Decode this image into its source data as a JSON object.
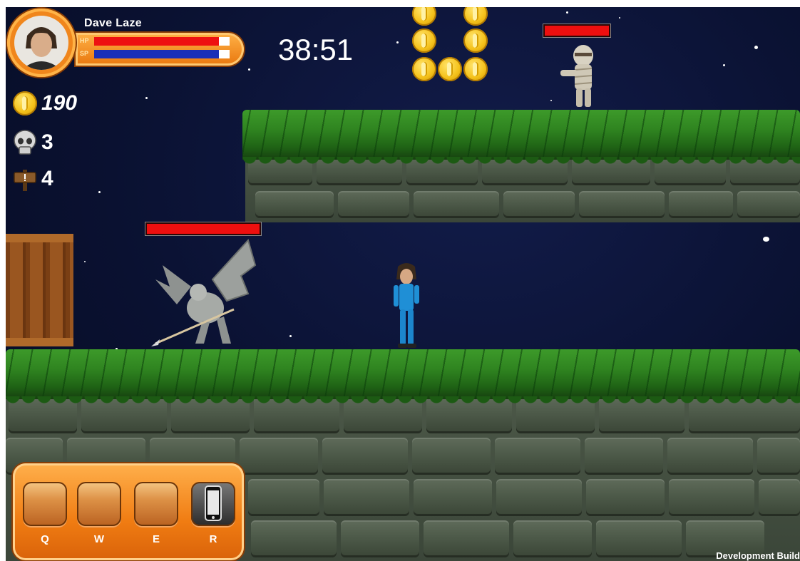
{
  "hud": {
    "player_name": "Dave Laze",
    "hp_label": "HP",
    "sp_label": "SP",
    "hp_fraction": 0.92,
    "sp_fraction": 0.92,
    "timer": "38:51",
    "coins": "190",
    "kills": "3",
    "signs": "4"
  },
  "enemies": [
    {
      "name": "mummy",
      "hp_fraction": 1.0
    },
    {
      "name": "gargoyle",
      "hp_fraction": 1.0
    }
  ],
  "skills": {
    "keys": [
      "Q",
      "W",
      "E",
      "R"
    ]
  },
  "footer": {
    "dev_build": "Development Build"
  },
  "colors": {
    "hp": "#ee1111",
    "sp": "#1a2fb8",
    "hud_orange": "#f07c12",
    "grass": "#2f8420"
  }
}
